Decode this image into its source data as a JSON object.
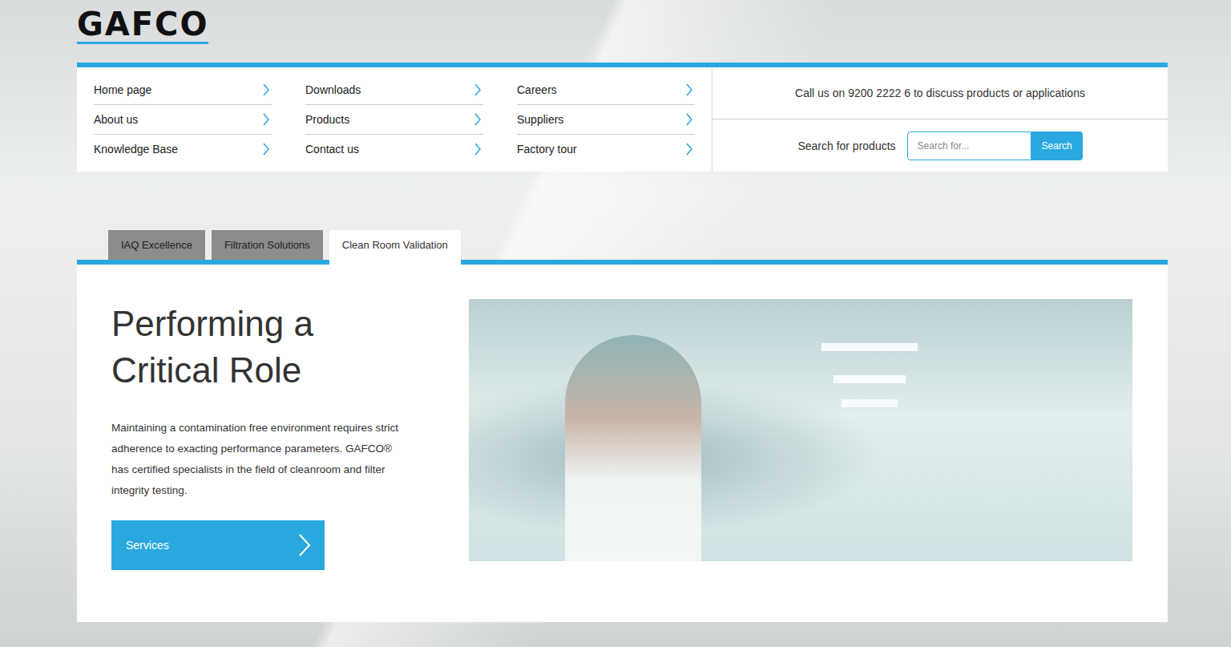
{
  "logo": {
    "text": "GAFCO"
  },
  "nav": {
    "columns": [
      [
        {
          "label": "Home page"
        },
        {
          "label": "About us"
        },
        {
          "label": "Knowledge Base"
        }
      ],
      [
        {
          "label": "Downloads"
        },
        {
          "label": "Products"
        },
        {
          "label": "Contact us"
        }
      ],
      [
        {
          "label": "Careers"
        },
        {
          "label": "Suppliers"
        },
        {
          "label": "Factory tour"
        }
      ]
    ]
  },
  "contact": {
    "text": "Call us on 9200 2222 6 to discuss products or applications"
  },
  "search": {
    "label": "Search for products",
    "placeholder": "Search for...",
    "button": "Search"
  },
  "tabs": [
    {
      "label": "IAQ Excellence",
      "selected": false
    },
    {
      "label": "Filtration Solutions",
      "selected": false
    },
    {
      "label": "Clean Room Validation",
      "selected": true
    }
  ],
  "hero": {
    "heading": "Performing a Critical Role",
    "paragraph": "Maintaining a contamination free environment requires strict adherence to exacting performance parameters. GAFCO® has certified specialists in the field of cleanroom and filter integrity testing.",
    "button": "Services"
  }
}
